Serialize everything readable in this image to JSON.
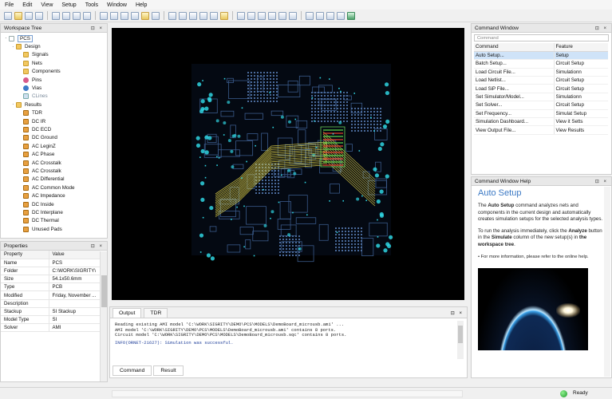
{
  "menu": [
    "File",
    "Edit",
    "View",
    "Setup",
    "Tools",
    "Window",
    "Help"
  ],
  "workspace": {
    "title": "Workspace Tree",
    "controls": "⊡ ×",
    "items": [
      {
        "label": "PCS",
        "level": 0,
        "icon": "pcs-root-icon",
        "expand": "-"
      },
      {
        "label": "Design",
        "level": 1,
        "icon": "folder-icon",
        "expand": "-"
      },
      {
        "label": "Signals",
        "level": 2,
        "icon": "folder-icon",
        "expand": ""
      },
      {
        "label": "Nets",
        "level": 2,
        "icon": "folder-icon",
        "expand": ""
      },
      {
        "label": "Components",
        "level": 2,
        "icon": "folder-icon",
        "expand": ""
      },
      {
        "label": "Pins",
        "level": 2,
        "icon": "pins-icon",
        "expand": ""
      },
      {
        "label": "Vias",
        "level": 2,
        "icon": "vias-icon",
        "expand": ""
      },
      {
        "label": "CLines",
        "level": 2,
        "icon": "clines-icon",
        "expand": ""
      },
      {
        "label": "Results",
        "level": 1,
        "icon": "results-folder-icon",
        "expand": "-"
      },
      {
        "label": "TDR",
        "level": 2,
        "icon": "result-icon",
        "expand": ""
      },
      {
        "label": "DC IR",
        "level": 2,
        "icon": "result-icon",
        "expand": ""
      },
      {
        "label": "DC ECD",
        "level": 2,
        "icon": "result-icon",
        "expand": ""
      },
      {
        "label": "DC Ground",
        "level": 2,
        "icon": "result-icon",
        "expand": ""
      },
      {
        "label": "AC LeginZ",
        "level": 2,
        "icon": "result-icon",
        "expand": ""
      },
      {
        "label": "AC Phase",
        "level": 2,
        "icon": "result-icon",
        "expand": ""
      },
      {
        "label": "AC Crosstalk",
        "level": 2,
        "icon": "result-icon",
        "expand": ""
      },
      {
        "label": "AC Crosstalk",
        "level": 2,
        "icon": "result-icon",
        "expand": ""
      },
      {
        "label": "AC Differential",
        "level": 2,
        "icon": "result-icon",
        "expand": ""
      },
      {
        "label": "AC Common Mode",
        "level": 2,
        "icon": "result-icon",
        "expand": ""
      },
      {
        "label": "AC Impedance",
        "level": 2,
        "icon": "result-icon",
        "expand": ""
      },
      {
        "label": "DC Inside",
        "level": 2,
        "icon": "result-icon",
        "expand": ""
      },
      {
        "label": "DC Interplane",
        "level": 2,
        "icon": "result-icon",
        "expand": ""
      },
      {
        "label": "DC Thermal",
        "level": 2,
        "icon": "result-icon",
        "expand": ""
      },
      {
        "label": "Unused Pads",
        "level": 2,
        "icon": "result-icon",
        "expand": ""
      }
    ]
  },
  "properties": {
    "title": "Properties",
    "controls": "⊡ ×",
    "header": {
      "property": "Property",
      "value": "Value"
    },
    "rows": [
      {
        "k": "Name",
        "v": "PCS"
      },
      {
        "k": "Folder",
        "v": "C:\\WORK\\SIGRITY\\"
      },
      {
        "k": "Size",
        "v": "54.1x50.6mm"
      },
      {
        "k": "Type",
        "v": "PCB"
      },
      {
        "k": "Modified",
        "v": "Friday, November ..."
      },
      {
        "k": "Description",
        "v": ""
      },
      {
        "k": "Stackup",
        "v": "SI Stackup"
      },
      {
        "k": "Model Type",
        "v": "SI"
      },
      {
        "k": "Solver",
        "v": "AMI"
      }
    ]
  },
  "output": {
    "controls": "⊡ ×",
    "tabs": [
      "Output",
      "TDR"
    ],
    "lines": [
      "Reading existing AMI model 'C:\\WORK\\SIGRITY\\DEMO\\PCS\\MODELS\\DemoBoard_microusb.ami' ...",
      "AMI model 'C:\\WORK\\SIGRITY\\DEMO\\PCS\\MODELS\\DemoBoard_microusb.ami' contains 8 ports.",
      "Circuit model 'C:\\WORK\\SIGRITY\\DEMO\\PCS\\MODELS\\DemoBoard_microusb.sqc' contains 8 ports."
    ],
    "info": "INFO(ORNET-21627): Simulation was successful.",
    "bottom_tabs": [
      "Command",
      "Result"
    ]
  },
  "command_window": {
    "title": "Command Window",
    "controls": "⊡ ×",
    "input_placeholder": "Command",
    "header": {
      "command": "Command",
      "feature": "Feature"
    },
    "rows": [
      {
        "command": "Auto Setup...",
        "feature": "Setup",
        "selected": true
      },
      {
        "command": "Batch Setup...",
        "feature": "Circuit Setup"
      },
      {
        "command": "Load Circuit File...",
        "feature": "Simulationn"
      },
      {
        "command": "Load Netlist...",
        "feature": "Circuit Setup"
      },
      {
        "command": "Load SiP File...",
        "feature": "Circuit Setup"
      },
      {
        "command": "Set Simulator/Model...",
        "feature": "Simulationn"
      },
      {
        "command": "Set Solver...",
        "feature": "Circuit Setup"
      },
      {
        "command": "Set Frequency...",
        "feature": "Simulat Setup"
      },
      {
        "command": "Simulation Dashboard...",
        "feature": "View it Setts"
      },
      {
        "command": "View Output File...",
        "feature": "View Results"
      }
    ]
  },
  "help": {
    "title": "Command Window Help",
    "controls": "⊡ ×",
    "heading": "Auto Setup",
    "p1_pre": "The ",
    "p1_bold": "Auto Setup",
    "p1_post": " command analyzes nets and components in the current design and automatically creates simulation setups for the selected analysis types.",
    "p2_pre": "To run the analysis immediately, click the ",
    "p2_bold1": "Analyze",
    "p2_mid": " button in the ",
    "p2_bold2": "Simulate",
    "p2_mid2": " column of the new setup(s) in ",
    "p2_bold3": "the workspace tree",
    "p2_end": ".",
    "p3": "• For more information, please refer to the online help."
  },
  "status": {
    "ready": "Ready"
  },
  "colors": {
    "accent": "#3a78c4",
    "selection": "#cfe3f8",
    "board": "#0b1a33",
    "trace_cyan": "#2fd3e0",
    "trace_yellow": "#e8d84a",
    "trace_red": "#e04030"
  }
}
